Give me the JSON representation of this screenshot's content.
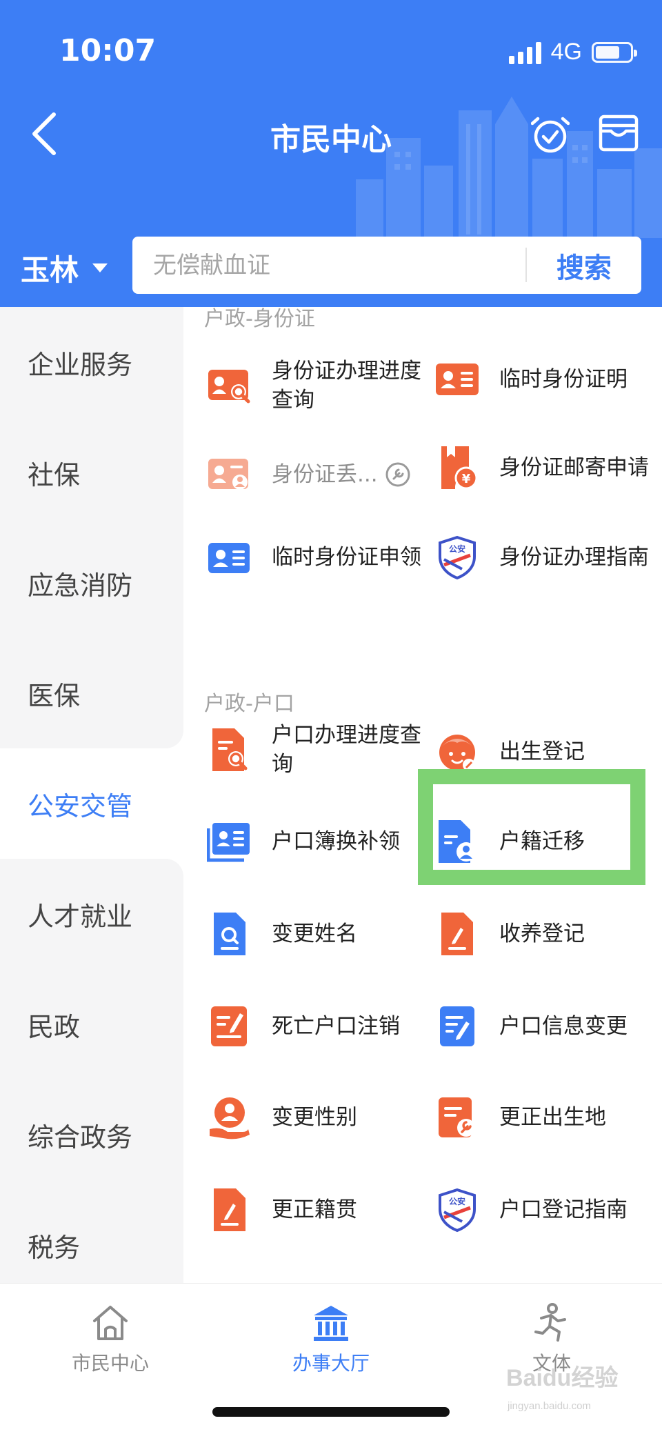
{
  "status_bar": {
    "time": "10:07",
    "network": "4G"
  },
  "header": {
    "title": "市民中心",
    "city": "玉林",
    "search": {
      "placeholder": "无偿献血证",
      "button_label": "搜索"
    }
  },
  "sidebar": {
    "items": [
      {
        "label": "企业服务",
        "active": false
      },
      {
        "label": "社保",
        "active": false
      },
      {
        "label": "应急消防",
        "active": false
      },
      {
        "label": "医保",
        "active": false
      },
      {
        "label": "公安交管",
        "active": true
      },
      {
        "label": "人才就业",
        "active": false
      },
      {
        "label": "民政",
        "active": false
      },
      {
        "label": "综合政务",
        "active": false
      },
      {
        "label": "税务",
        "active": false
      }
    ]
  },
  "sections": [
    {
      "title": "户政-身份证",
      "services": [
        {
          "label": "身份证办理进度查询",
          "icon": "id-card-search-icon"
        },
        {
          "label": "临时身份证明",
          "icon": "id-card-icon"
        },
        {
          "label": "身份证丢...",
          "icon": "id-card-lost-icon",
          "disabled": true
        },
        {
          "label": "身份证邮寄申请",
          "icon": "mail-yuan-icon"
        },
        {
          "label": "临时身份证申领",
          "icon": "id-card-blue-icon"
        },
        {
          "label": "身份证办理指南",
          "icon": "police-shield-icon",
          "badge": "公安"
        }
      ]
    },
    {
      "title": "户政-户口",
      "services": [
        {
          "label": "户口办理进度查询",
          "icon": "document-search-icon"
        },
        {
          "label": "出生登记",
          "icon": "baby-icon"
        },
        {
          "label": "户口簿换补领",
          "icon": "household-book-icon"
        },
        {
          "label": "户籍迁移",
          "icon": "document-person-icon",
          "highlighted": true
        },
        {
          "label": "变更姓名",
          "icon": "document-magnify-icon"
        },
        {
          "label": "收养登记",
          "icon": "document-pen-icon"
        },
        {
          "label": "死亡户口注销",
          "icon": "pen-list-icon"
        },
        {
          "label": "户口信息变更",
          "icon": "document-edit-blue-icon"
        },
        {
          "label": "变更性别",
          "icon": "person-hand-icon"
        },
        {
          "label": "更正出生地",
          "icon": "document-wrench-icon"
        },
        {
          "label": "更正籍贯",
          "icon": "document-pen-icon"
        },
        {
          "label": "户口登记指南",
          "icon": "police-shield-icon",
          "badge": "公安"
        }
      ]
    }
  ],
  "tabbar": {
    "tabs": [
      {
        "label": "市民中心",
        "icon": "home-icon",
        "active": false
      },
      {
        "label": "办事大厅",
        "icon": "government-building-icon",
        "active": true
      },
      {
        "label": "文体",
        "icon": "running-person-icon",
        "active": false
      }
    ]
  },
  "watermark": {
    "text": "Baidu经验",
    "sub": "jingyan.baidu.com"
  },
  "colors": {
    "primary": "#3d7ef5",
    "orange": "#f0653a",
    "highlight": "#7ed273"
  }
}
